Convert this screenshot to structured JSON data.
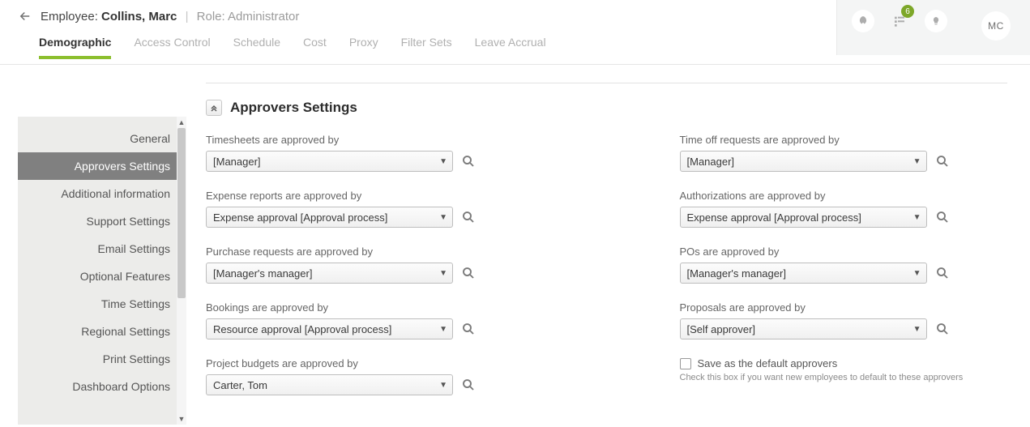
{
  "header": {
    "employee_prefix": "Employee: ",
    "employee_name": "Collins, Marc",
    "role_prefix": "Role: ",
    "role": "Administrator",
    "notification_count": "6",
    "avatar_initials": "MC"
  },
  "tabs": [
    {
      "label": "Demographic",
      "active": true
    },
    {
      "label": "Access Control",
      "active": false
    },
    {
      "label": "Schedule",
      "active": false
    },
    {
      "label": "Cost",
      "active": false
    },
    {
      "label": "Proxy",
      "active": false
    },
    {
      "label": "Filter Sets",
      "active": false
    },
    {
      "label": "Leave Accrual",
      "active": false
    }
  ],
  "sidebar": {
    "items": [
      {
        "label": "General",
        "active": false
      },
      {
        "label": "Approvers Settings",
        "active": true
      },
      {
        "label": "Additional information",
        "active": false
      },
      {
        "label": "Support Settings",
        "active": false
      },
      {
        "label": "Email Settings",
        "active": false
      },
      {
        "label": "Optional Features",
        "active": false
      },
      {
        "label": "Time Settings",
        "active": false
      },
      {
        "label": "Regional Settings",
        "active": false
      },
      {
        "label": "Print Settings",
        "active": false
      },
      {
        "label": "Dashboard Options",
        "active": false
      }
    ]
  },
  "section": {
    "title": "Approvers Settings"
  },
  "fields": {
    "timesheets": {
      "label": "Timesheets are approved by",
      "value": "[Manager]"
    },
    "timeoff": {
      "label": "Time off requests are approved by",
      "value": "[Manager]"
    },
    "expense": {
      "label": "Expense reports are approved by",
      "value": "Expense approval [Approval process]"
    },
    "auth": {
      "label": "Authorizations are approved by",
      "value": "Expense approval [Approval process]"
    },
    "purchase": {
      "label": "Purchase requests are approved by",
      "value": "[Manager's manager]"
    },
    "pos": {
      "label": "POs are approved by",
      "value": "[Manager's manager]"
    },
    "bookings": {
      "label": "Bookings are approved by",
      "value": "Resource approval [Approval process]"
    },
    "proposals": {
      "label": "Proposals are approved by",
      "value": "[Self approver]"
    },
    "budgets": {
      "label": "Project budgets are approved by",
      "value": "Carter, Tom"
    }
  },
  "defaults": {
    "checkbox_label": "Save as the default approvers",
    "hint": "Check this box if you want new employees to default to these approvers"
  }
}
